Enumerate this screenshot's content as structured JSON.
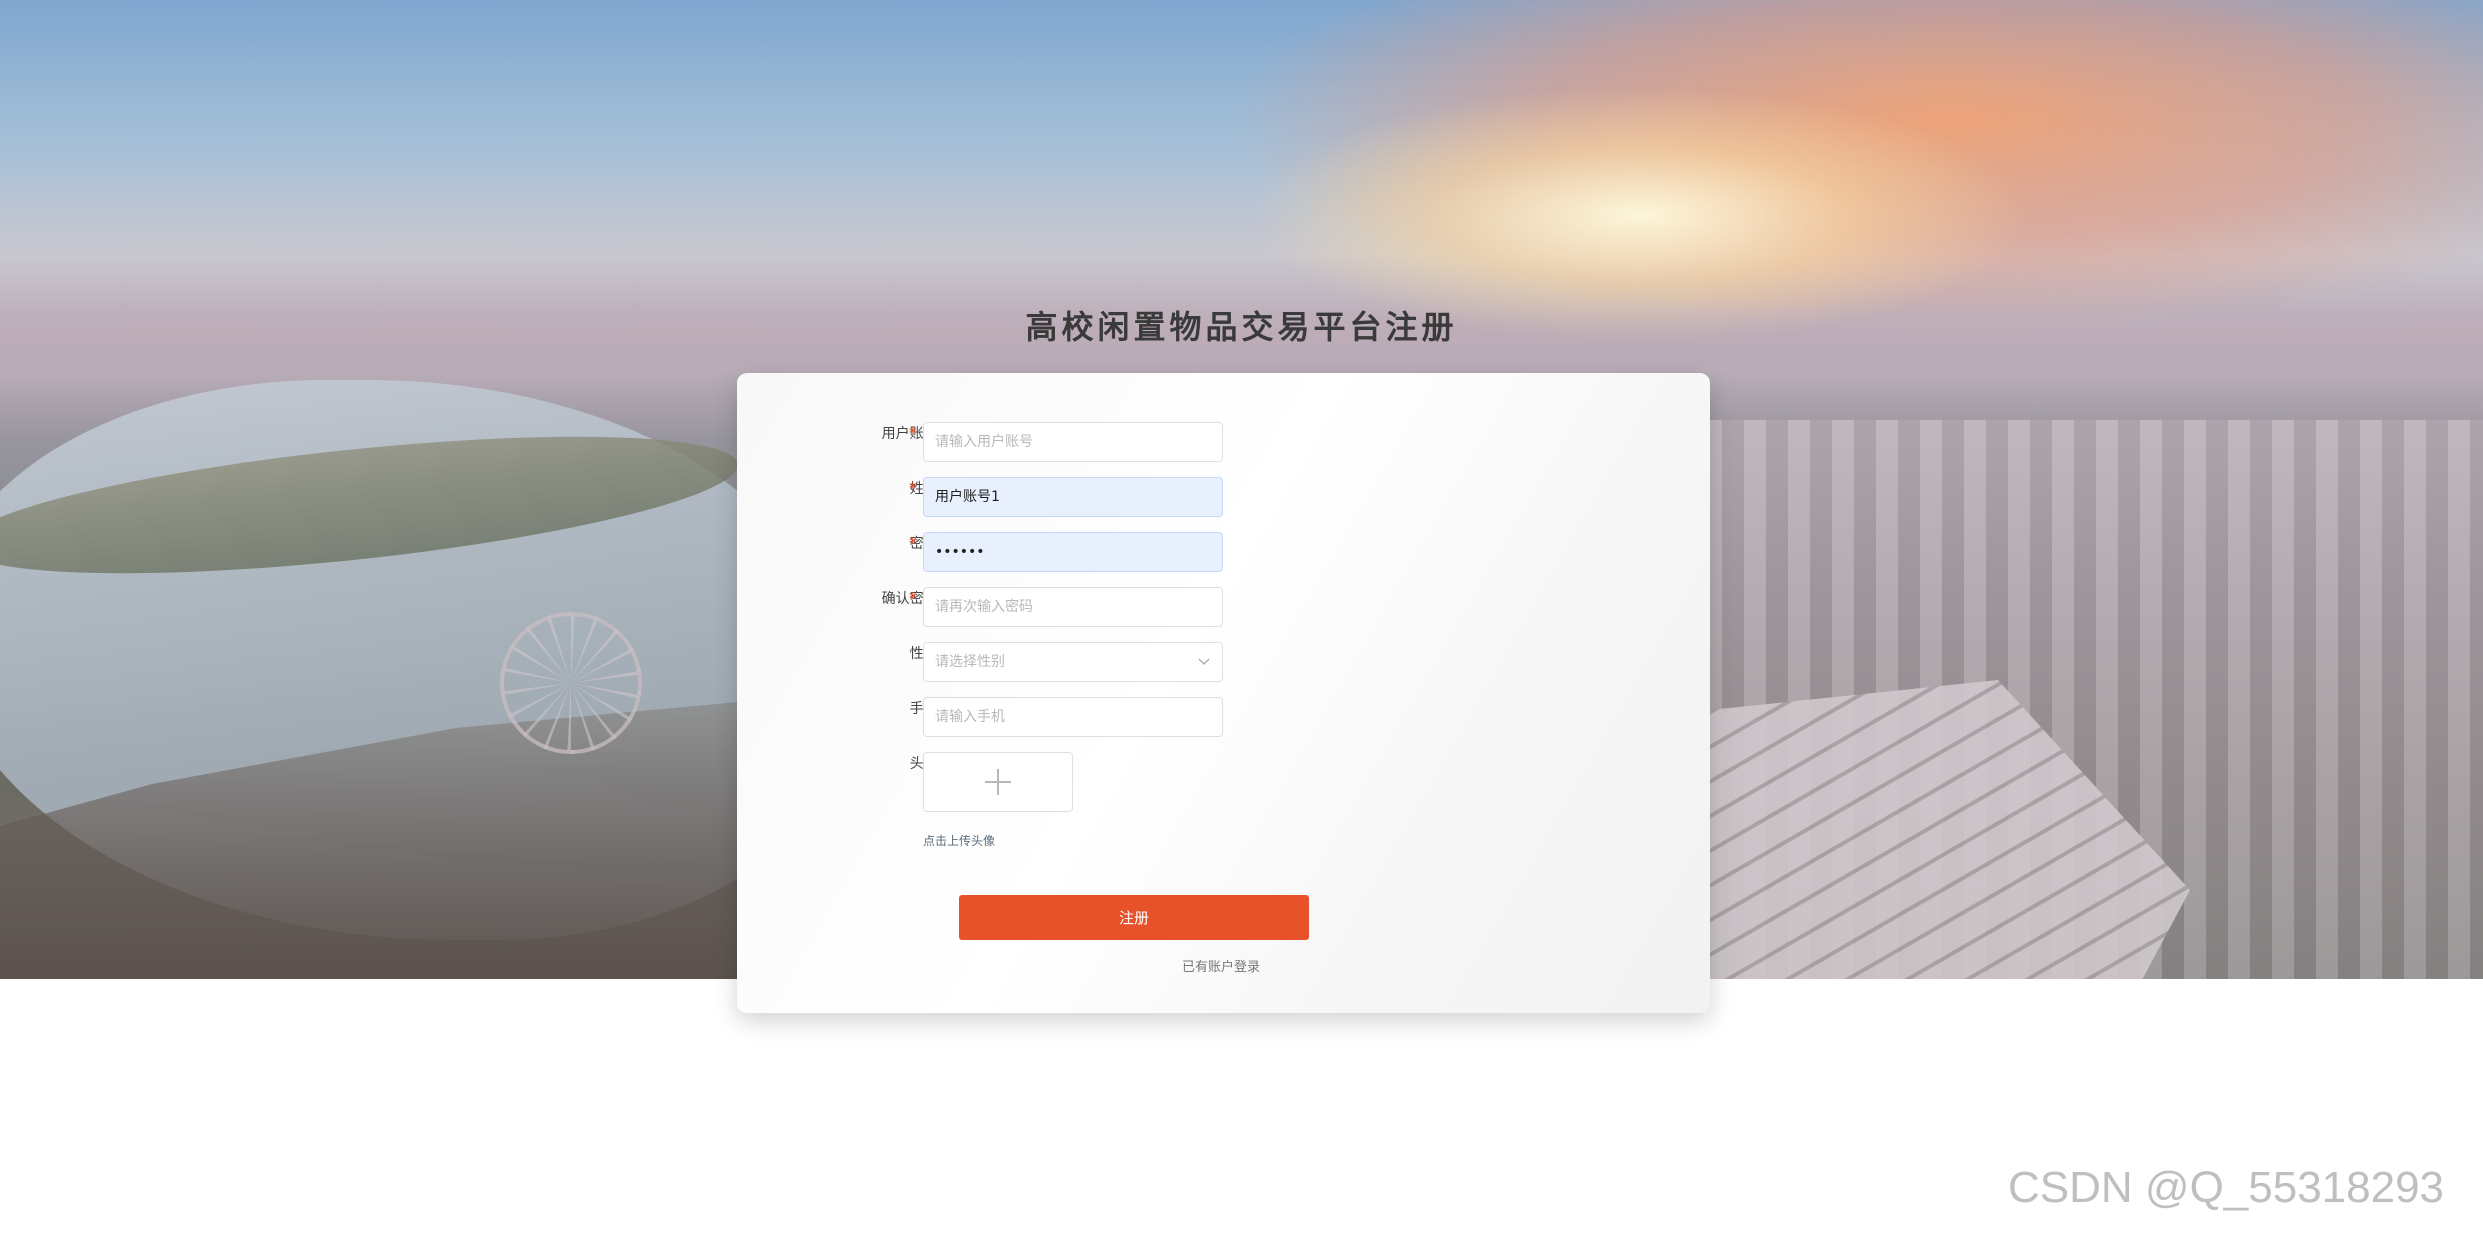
{
  "title": "高校闲置物品交易平台注册",
  "form": {
    "username": {
      "label": "用户账号:",
      "required": "*",
      "placeholder": "请输入用户账号",
      "value": ""
    },
    "name": {
      "label": "姓名:",
      "required": "*",
      "value": "用户账号1"
    },
    "password": {
      "label": "密码:",
      "required": "*",
      "value": "••••••"
    },
    "confirm_password": {
      "label": "确认密码:",
      "required": "*",
      "placeholder": "请再次输入密码"
    },
    "gender": {
      "label": "性别:",
      "placeholder": "请选择性别"
    },
    "phone": {
      "label": "手机:",
      "placeholder": "请输入手机"
    },
    "avatar": {
      "label": "头像:",
      "hint": "点击上传头像"
    },
    "submit_label": "注册",
    "login_link": "已有账户登录"
  },
  "watermark": "CSDN @Q_55318293",
  "colors": {
    "accent": "#e8522a",
    "required": "#e8431f",
    "autofill": "#e8effd"
  },
  "icons": {
    "gender_dropdown": "chevron-down-icon",
    "avatar_upload": "plus-icon"
  }
}
